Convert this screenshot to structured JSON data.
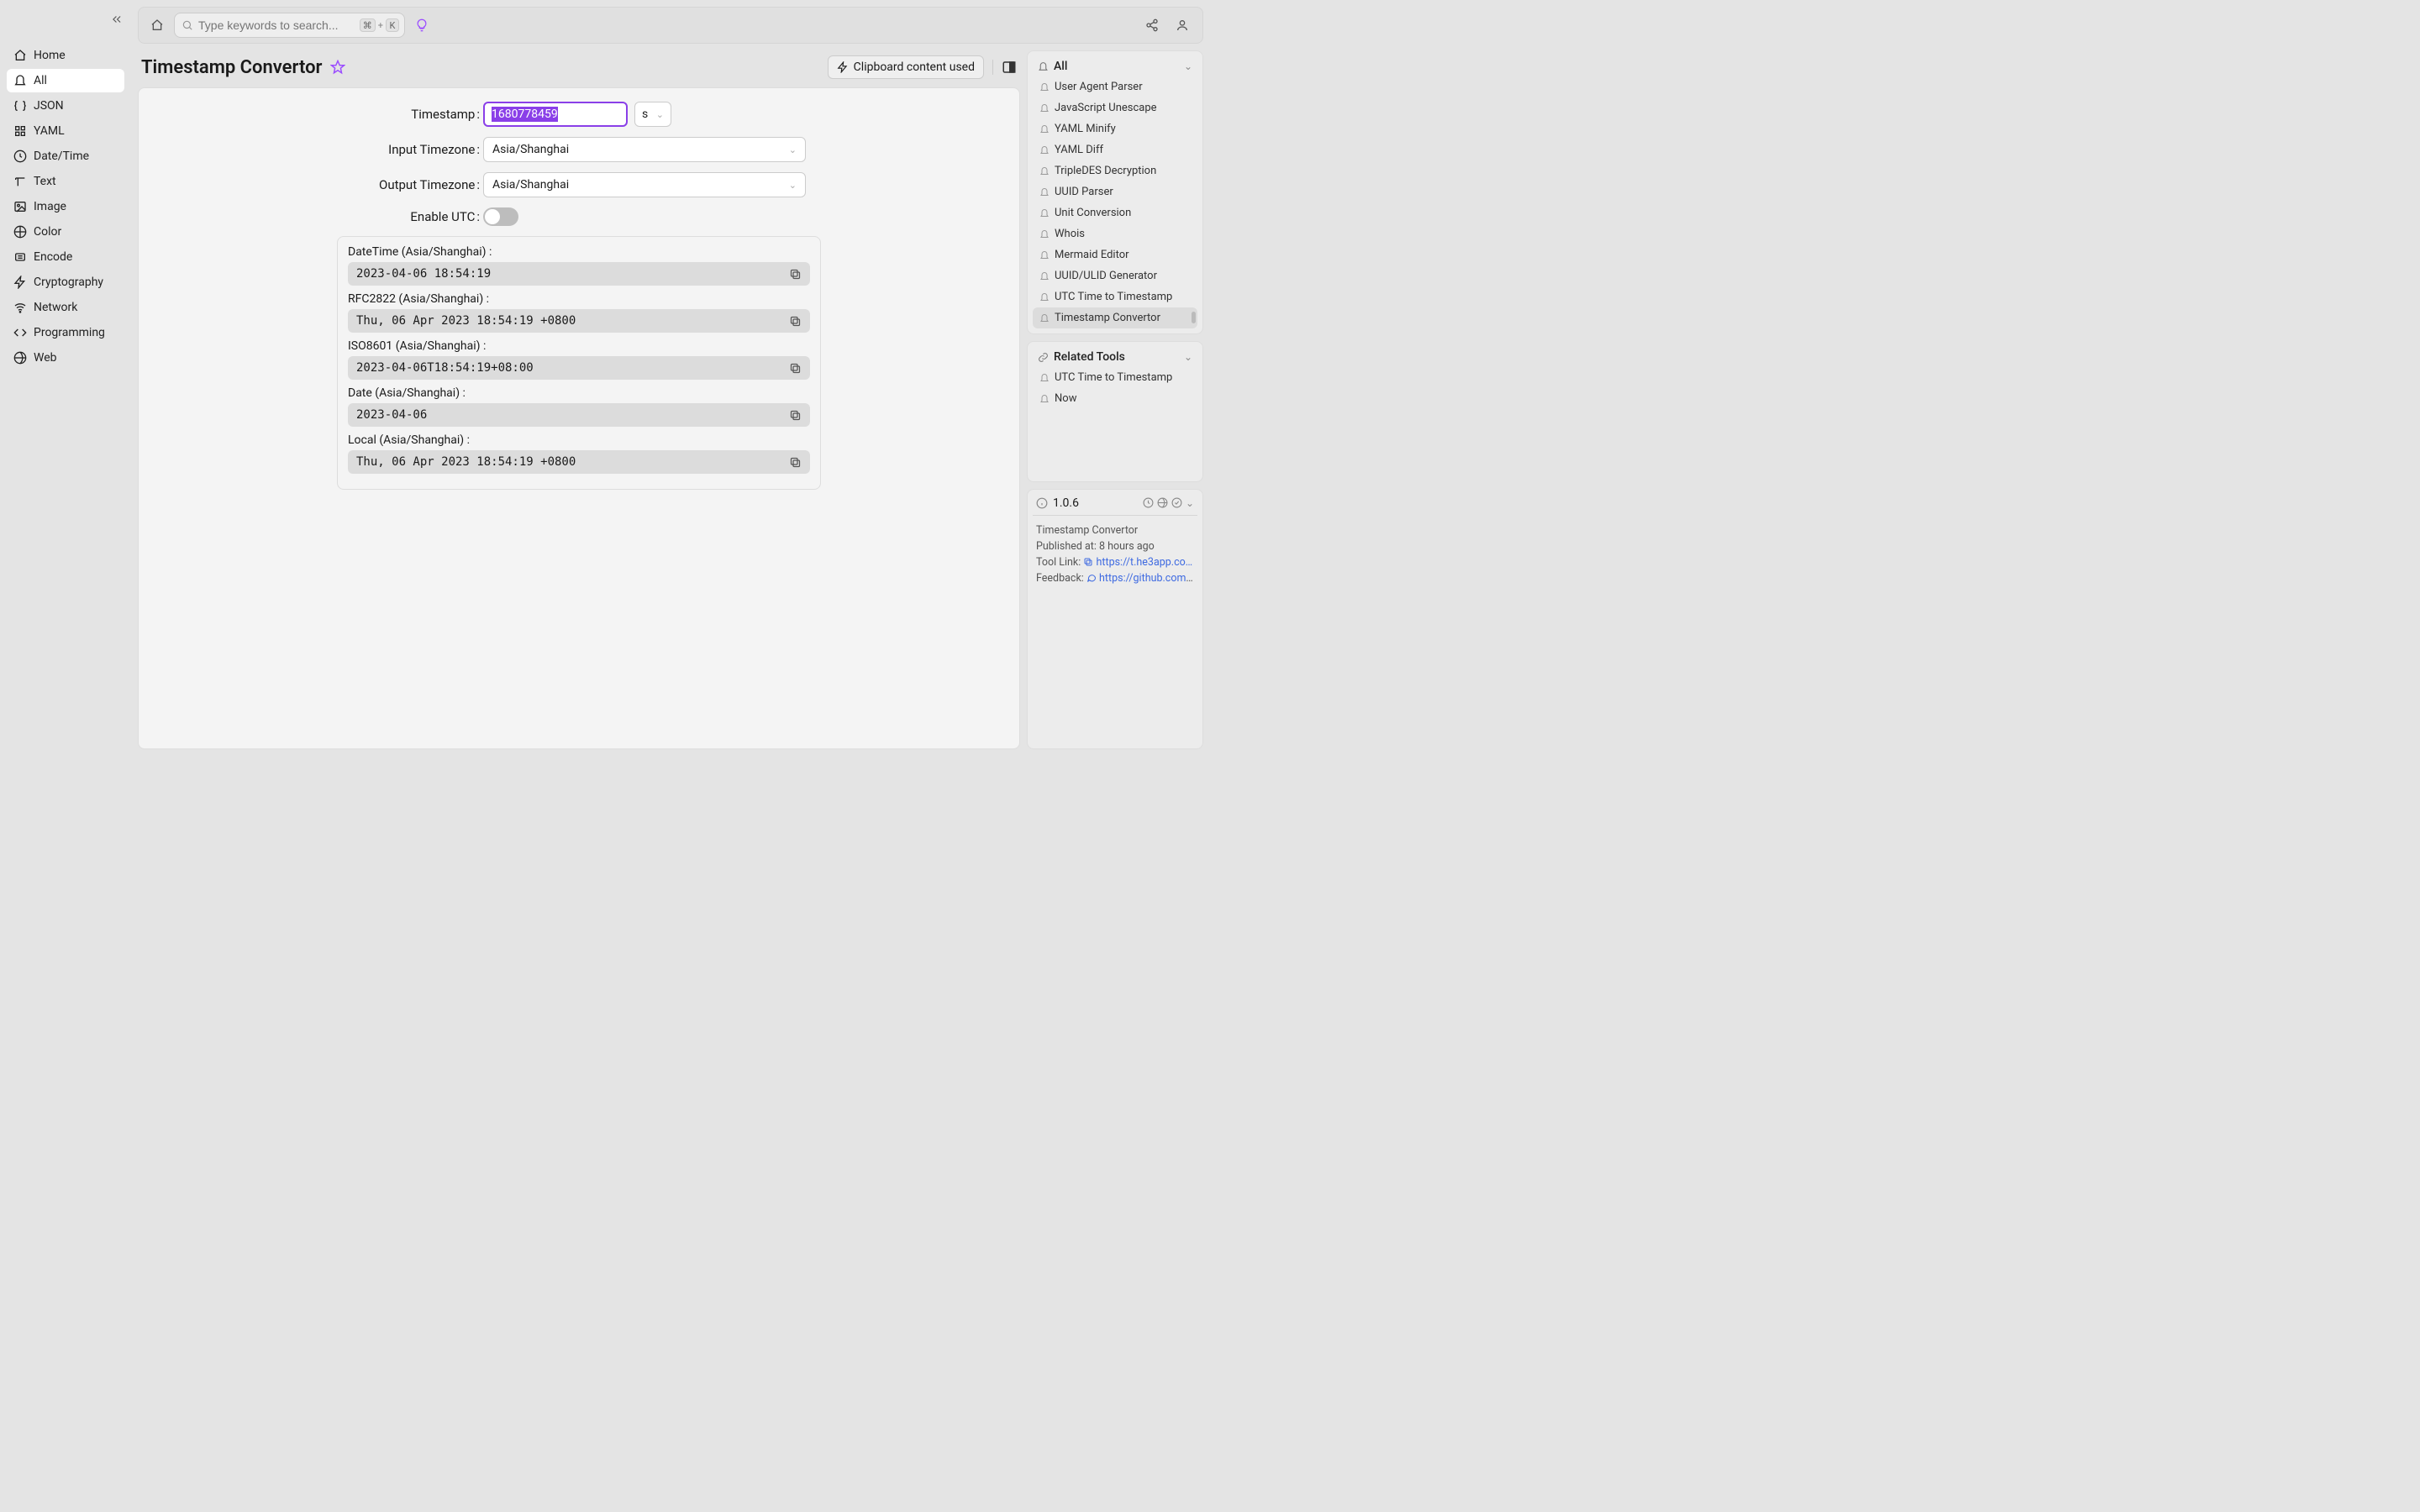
{
  "sidebar": {
    "items": [
      {
        "label": "Home",
        "icon": "home"
      },
      {
        "label": "All",
        "icon": "bell",
        "active": true
      },
      {
        "label": "JSON",
        "icon": "braces"
      },
      {
        "label": "YAML",
        "icon": "grid"
      },
      {
        "label": "Date/Time",
        "icon": "clock"
      },
      {
        "label": "Text",
        "icon": "text"
      },
      {
        "label": "Image",
        "icon": "image"
      },
      {
        "label": "Color",
        "icon": "palette"
      },
      {
        "label": "Encode",
        "icon": "hash"
      },
      {
        "label": "Cryptography",
        "icon": "bolt"
      },
      {
        "label": "Network",
        "icon": "wifi"
      },
      {
        "label": "Programming",
        "icon": "code"
      },
      {
        "label": "Web",
        "icon": "globe"
      }
    ]
  },
  "topbar": {
    "search_placeholder": "Type keywords to search...",
    "shortcut_keys": [
      "⌘",
      "K"
    ]
  },
  "page": {
    "title": "Timestamp Convertor",
    "clipboard_btn_label": "Clipboard content used"
  },
  "form": {
    "timestamp_label": "Timestamp",
    "timestamp_value": "1680778459",
    "unit_value": "s",
    "input_tz_label": "Input Timezone",
    "input_tz_value": "Asia/Shanghai",
    "output_tz_label": "Output Timezone",
    "output_tz_value": "Asia/Shanghai",
    "enable_utc_label": "Enable UTC",
    "enable_utc_value": false
  },
  "results": [
    {
      "label": "DateTime (Asia/Shanghai) :",
      "value": "2023-04-06 18:54:19"
    },
    {
      "label": "RFC2822 (Asia/Shanghai) :",
      "value": "Thu, 06 Apr 2023 18:54:19 +0800"
    },
    {
      "label": "ISO8601 (Asia/Shanghai) :",
      "value": "2023-04-06T18:54:19+08:00"
    },
    {
      "label": "Date (Asia/Shanghai) :",
      "value": "2023-04-06"
    },
    {
      "label": "Local (Asia/Shanghai) :",
      "value": "Thu, 06 Apr 2023 18:54:19 +0800"
    }
  ],
  "right": {
    "all_header": "All",
    "tools": [
      "User Agent Parser",
      "JavaScript Unescape",
      "YAML Minify",
      "YAML Diff",
      "TripleDES Decryption",
      "UUID Parser",
      "Unit Conversion",
      "Whois",
      "Mermaid Editor",
      "UUID/ULID Generator",
      "UTC Time to Timestamp",
      "Timestamp Convertor"
    ],
    "tools_active_index": 11,
    "related_header": "Related Tools",
    "related": [
      "UTC Time to Timestamp",
      "Now"
    ],
    "version": "1.0.6",
    "meta_title": "Timestamp Convertor",
    "published_label": "Published at:",
    "published_value": "8 hours ago",
    "tool_link_label": "Tool Link:",
    "tool_link_value": "https://t.he3app.co…",
    "feedback_label": "Feedback:",
    "feedback_value": "https://github.com/…"
  }
}
